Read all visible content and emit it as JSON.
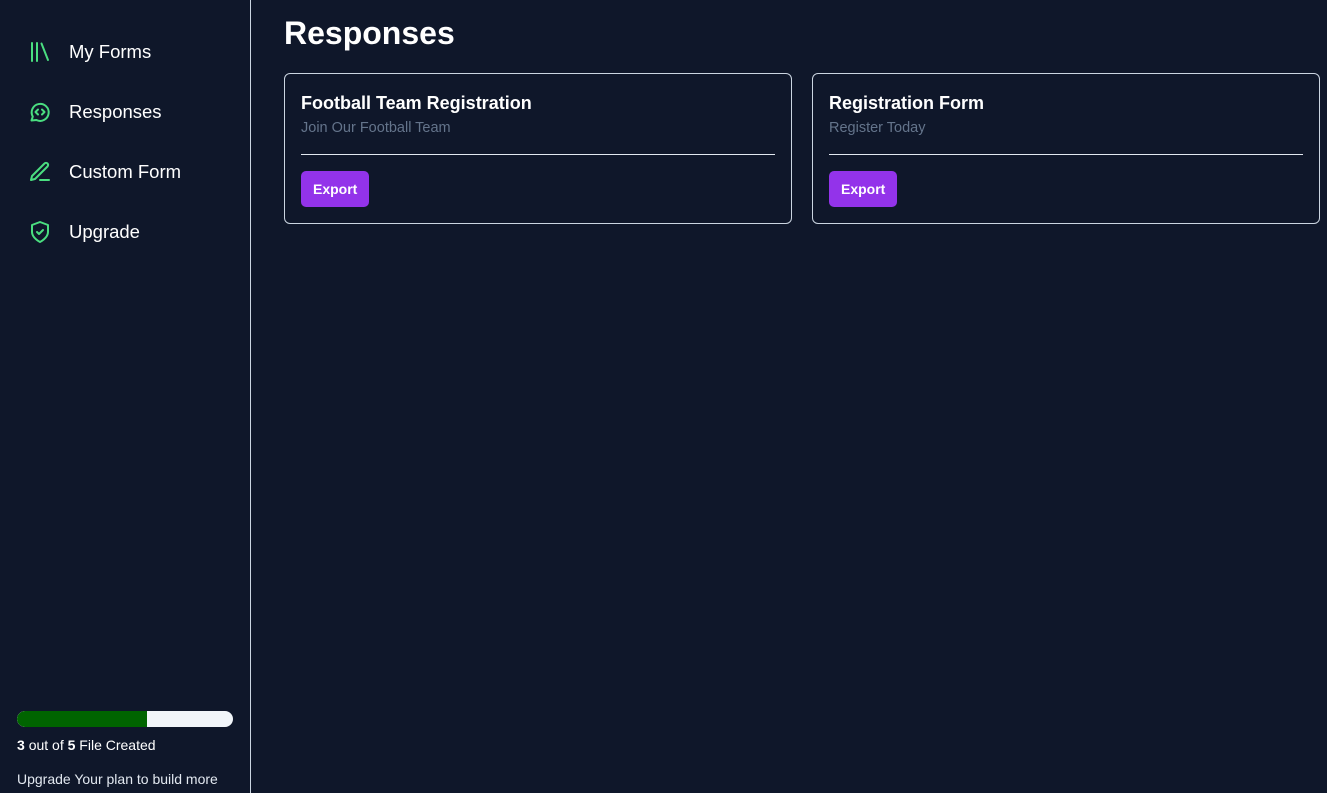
{
  "sidebar": {
    "items": [
      {
        "label": "My Forms",
        "icon": "library-icon"
      },
      {
        "label": "Responses",
        "icon": "message-code-icon"
      },
      {
        "label": "Custom Form",
        "icon": "pencil-icon"
      },
      {
        "label": "Upgrade",
        "icon": "shield-check-icon"
      }
    ],
    "usage": {
      "created": "3",
      "out_of_text": "out of",
      "total": "5",
      "suffix_text": "File Created",
      "progress_fraction": 0.6
    },
    "upgrade_note": "Upgrade Your plan to build more forms"
  },
  "main": {
    "title": "Responses",
    "cards": [
      {
        "title": "Football Team Registration",
        "description": "Join Our Football Team",
        "button_label": "Export"
      },
      {
        "title": "Registration Form",
        "description": "Register Today",
        "button_label": "Export"
      }
    ]
  },
  "colors": {
    "background": "#0f172a",
    "icon_accent": "#4ade80",
    "progress_fill": "#006400",
    "progress_track": "#f1f5f9",
    "button": "#9333ea",
    "muted_text": "#64748b",
    "border": "#cbd5e1"
  }
}
